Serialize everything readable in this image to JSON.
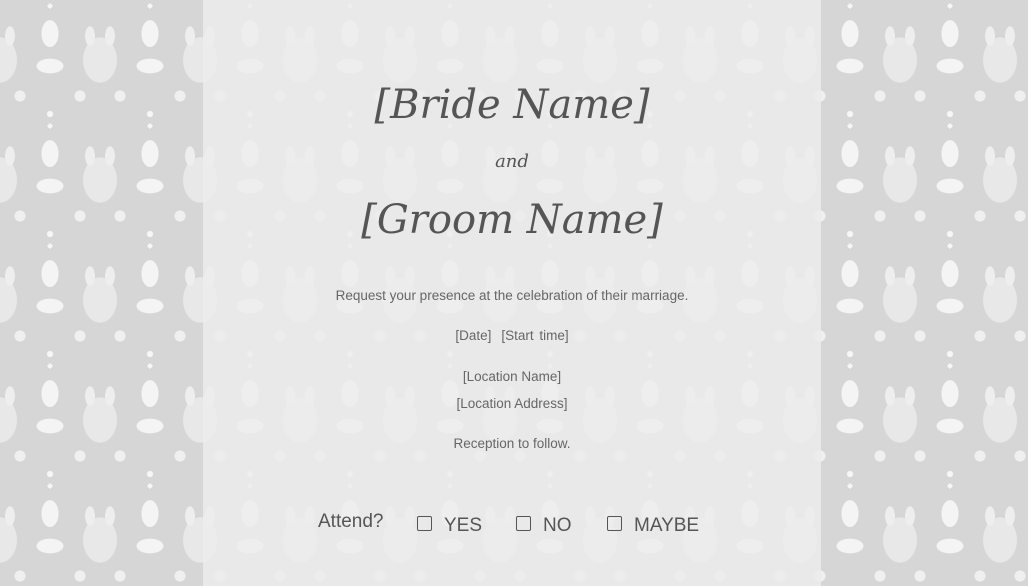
{
  "invitation": {
    "bride_name": "[Bride Name]",
    "and": "and",
    "groom_name": "[Groom Name]",
    "request": "Request your presence at the celebration of their marriage.",
    "date": "[Date]",
    "start_time": "[Start time]",
    "location_name": "[Location Name]",
    "location_address": "[Location Address]",
    "reception": "Reception to follow."
  },
  "rsvp": {
    "label": "Attend?",
    "options": [
      {
        "label": "YES",
        "checked": false
      },
      {
        "label": "NO",
        "checked": false
      },
      {
        "label": "MAYBE",
        "checked": false
      }
    ]
  },
  "colors": {
    "background": "#d6d6d6",
    "pattern": "#f4f4f4",
    "card": "#ececec",
    "text": "#555555"
  }
}
